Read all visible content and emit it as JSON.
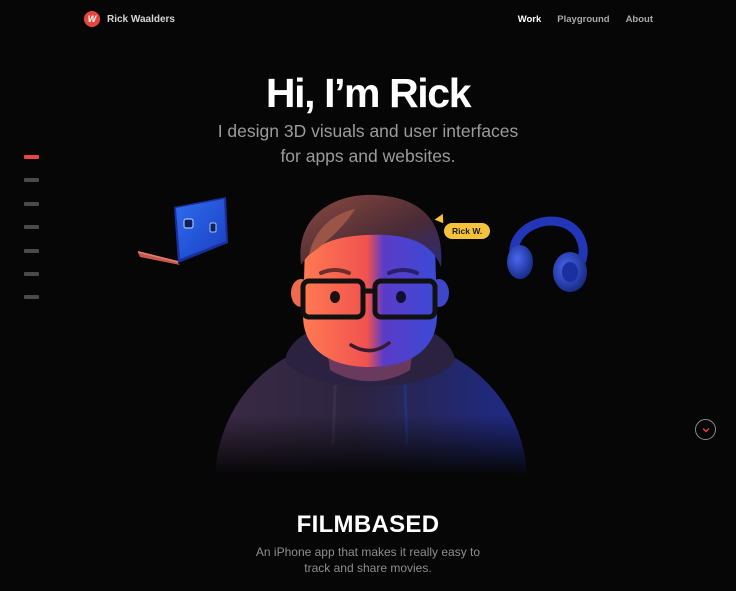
{
  "header": {
    "brand_name": "Rick Waalders",
    "brand_logo_letter": "W",
    "nav": [
      {
        "label": "Work",
        "active": true
      },
      {
        "label": "Playground",
        "active": false
      },
      {
        "label": "About",
        "active": false
      }
    ]
  },
  "hero": {
    "title": "Hi, I’m Rick",
    "subtitle_line1": "I design 3D visuals and user interfaces",
    "subtitle_line2": "for apps and websites.",
    "name_tag": "Rick W."
  },
  "section_indicator": {
    "count": 7,
    "active_index": 0
  },
  "project": {
    "title": "FILMBASED",
    "description_line1": "An iPhone app that makes it really easy to",
    "description_line2": "track and share movies."
  },
  "icons": {
    "scroll": "chevron-down-icon",
    "laptop": "laptop-icon",
    "headphones": "headphones-icon"
  },
  "colors": {
    "accent": "#e5473f",
    "tag": "#f5c33b",
    "background": "#060606"
  }
}
